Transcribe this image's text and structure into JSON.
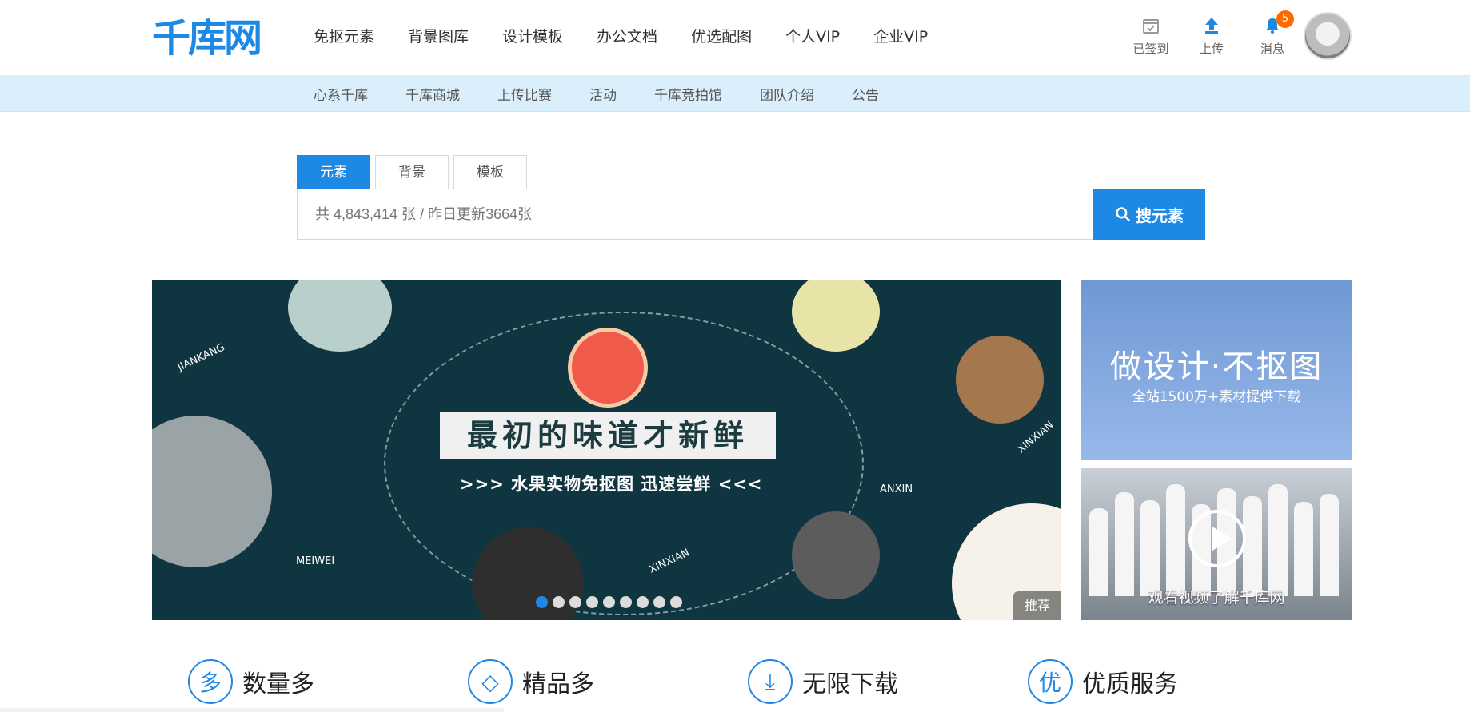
{
  "header": {
    "logo": "千库网",
    "nav": [
      "免抠元素",
      "背景图库",
      "设计模板",
      "办公文档",
      "优选配图",
      "个人VIP",
      "企业VIP"
    ],
    "tools": [
      {
        "label": "已签到",
        "icon": "calendar-check-icon"
      },
      {
        "label": "上传",
        "icon": "upload-icon"
      },
      {
        "label": "消息",
        "icon": "bell-icon",
        "badge": "5"
      }
    ]
  },
  "subnav": [
    "心系千库",
    "千库商城",
    "上传比赛",
    "活动",
    "千库竞拍馆",
    "团队介绍",
    "公告"
  ],
  "search": {
    "tabs": [
      "元素",
      "背景",
      "模板"
    ],
    "active_tab": "元素",
    "placeholder": "共 4,843,414 张 / 昨日更新3664张",
    "button": "搜元素"
  },
  "banner": {
    "title": "最初的味道才新鲜",
    "subtitle": ">>> 水果实物免抠图  迅速尝鲜 <<<",
    "tag": "推荐",
    "dots": 9,
    "active_dot": 0,
    "words": [
      "JIANKANG",
      "MEIWEI",
      "XINXIAN",
      "ANXIN",
      "XINXIAN"
    ]
  },
  "promos": {
    "promo1_title": "做设计·不抠图",
    "promo1_sub": "全站1500万+素材提供下载",
    "promo2_caption": "观看视频了解千库网"
  },
  "features": [
    {
      "icon": "多",
      "label": "数量多"
    },
    {
      "icon": "◇",
      "label": "精品多"
    },
    {
      "icon": "⤓",
      "label": "无限下载"
    },
    {
      "icon": "优",
      "label": "优质服务"
    }
  ],
  "colors": {
    "accent": "#1e88e5",
    "badge": "#ff6a00",
    "subbar": "#dbeefc",
    "banner_bg": "#0f3540"
  }
}
